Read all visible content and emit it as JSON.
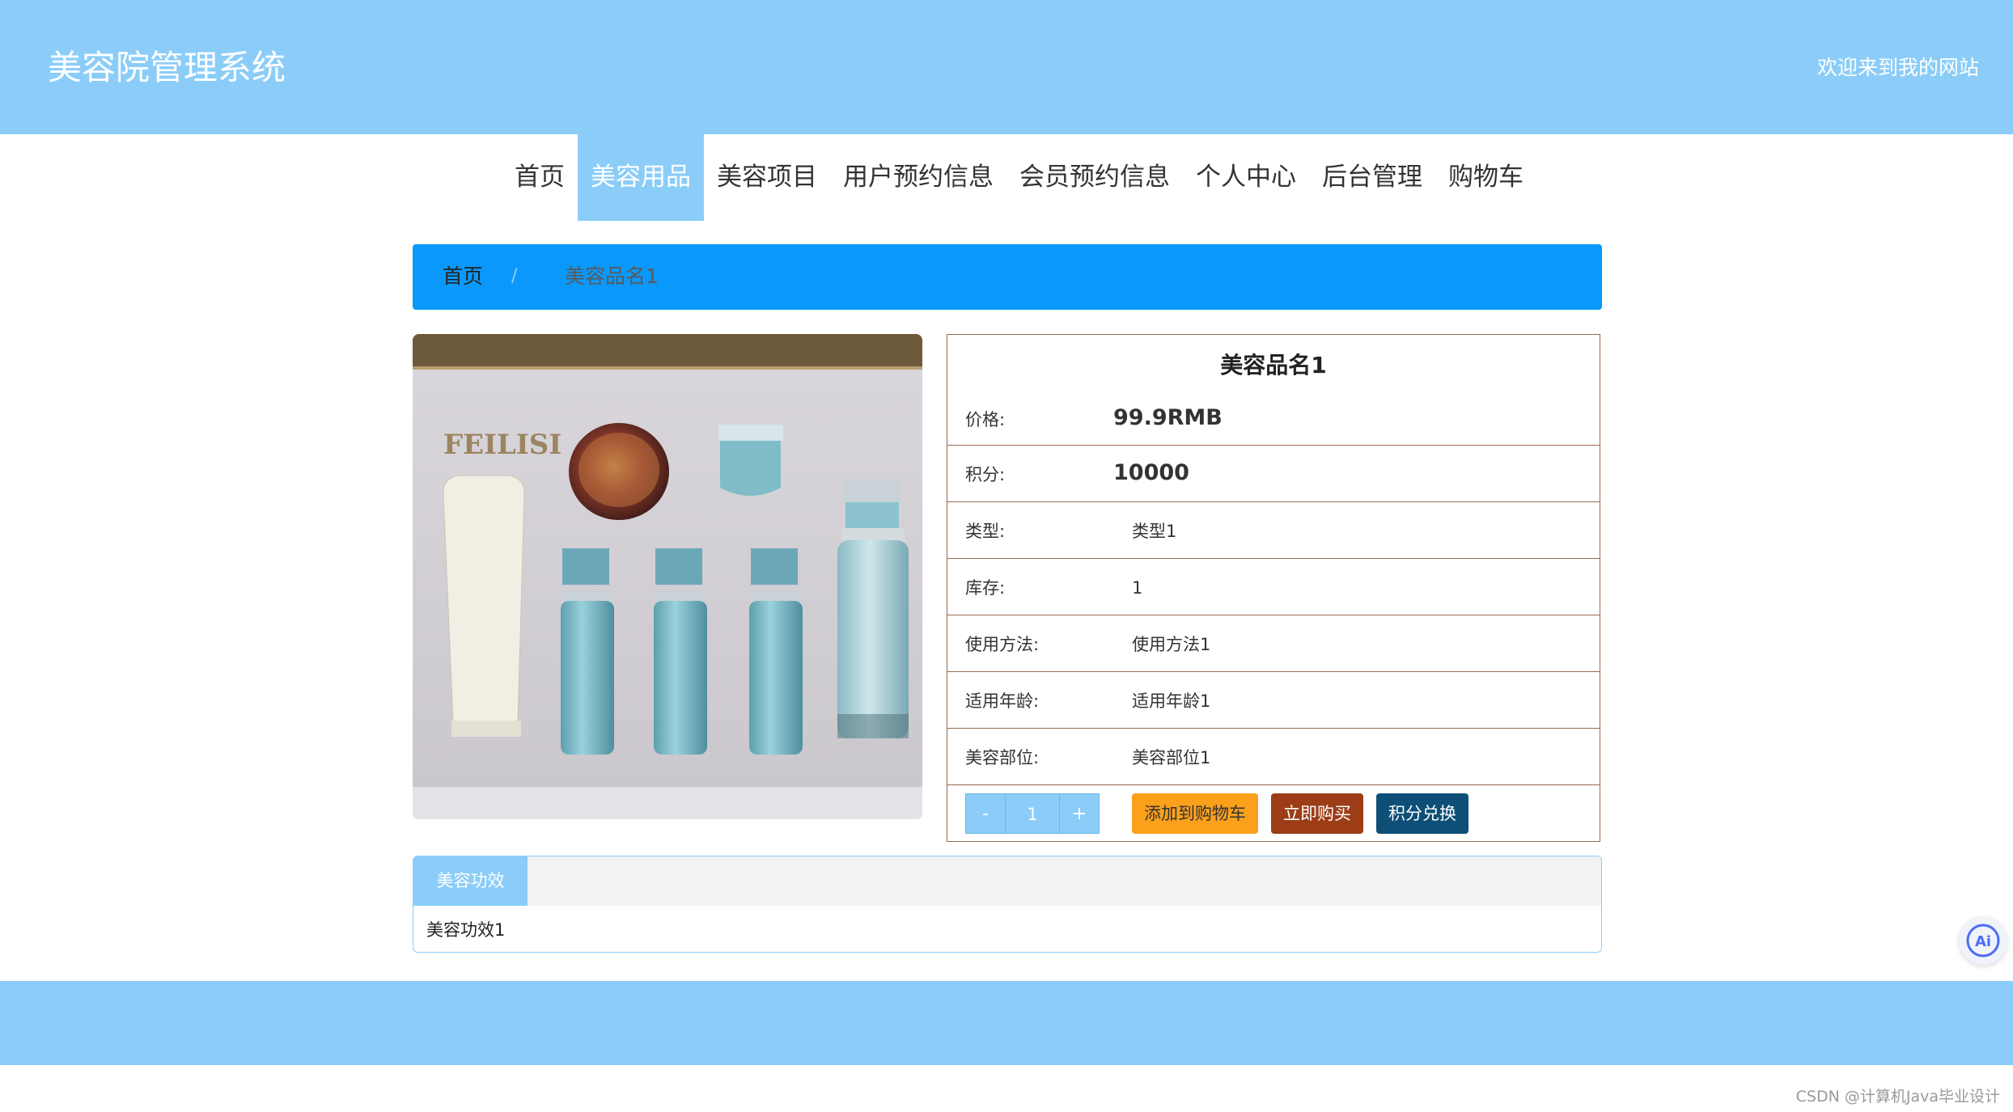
{
  "header": {
    "site_title": "美容院管理系统",
    "welcome_text": "欢迎来到我的网站"
  },
  "nav": {
    "items": [
      {
        "label": "首页",
        "active": false
      },
      {
        "label": "美容用品",
        "active": true
      },
      {
        "label": "美容项目",
        "active": false
      },
      {
        "label": "用户预约信息",
        "active": false
      },
      {
        "label": "会员预约信息",
        "active": false
      },
      {
        "label": "个人中心",
        "active": false
      },
      {
        "label": "后台管理",
        "active": false
      },
      {
        "label": "购物车",
        "active": false
      }
    ]
  },
  "breadcrumb": {
    "home": "首页",
    "separator": "/",
    "current": "美容品名1"
  },
  "product": {
    "image_alt_brand": "FEILISI",
    "name": "美容品名1",
    "price_label": "价格:",
    "price_value": "99.9RMB",
    "points_label": "积分:",
    "points_value": "10000",
    "type_label": "类型:",
    "type_value": "类型1",
    "stock_label": "库存:",
    "stock_value": "1",
    "usage_label": "使用方法:",
    "usage_value": "使用方法1",
    "age_label": "适用年龄:",
    "age_value": "适用年龄1",
    "part_label": "美容部位:",
    "part_value": "美容部位1"
  },
  "actions": {
    "minus": "-",
    "quantity": "1",
    "plus": "+",
    "add_to_cart": "添加到购物车",
    "buy_now": "立即购买",
    "points_exchange": "积分兑换"
  },
  "tabs": {
    "active_label": "美容功效",
    "content": "美容功效1"
  },
  "floating": {
    "ai_label": "Ai"
  },
  "watermark": "CSDN @计算机Java毕业设计",
  "colors": {
    "header_bg": "#8bcdf8",
    "breadcrumb_bg": "#0a99fa",
    "price": "#e21c1c",
    "points": "#8b3d14",
    "cart_button": "#fba01b",
    "buy_button": "#9c3d17",
    "exchange_button": "#0e4f77"
  }
}
